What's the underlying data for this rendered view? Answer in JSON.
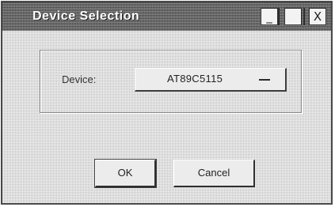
{
  "window": {
    "title": "Device Selection"
  },
  "titlebar_buttons": {
    "minimize_icon": "minimize-icon",
    "maximize_icon": "maximize-icon",
    "close_icon": "close-icon",
    "minimize_glyph": "_",
    "maximize_glyph": "",
    "close_glyph": "X"
  },
  "form": {
    "device_label": "Device:",
    "device_value": "AT89C5115"
  },
  "buttons": {
    "ok_label": "OK",
    "cancel_label": "Cancel"
  }
}
